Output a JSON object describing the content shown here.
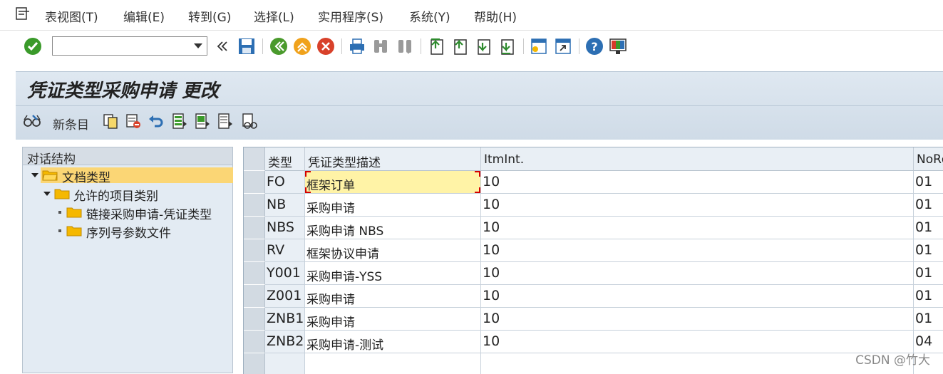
{
  "menu": {
    "items": [
      "表视图(T)",
      "编辑(E)",
      "转到(G)",
      "选择(L)",
      "实用程序(S)",
      "系统(Y)",
      "帮助(H)"
    ]
  },
  "toolbar": {
    "command_value": "",
    "icons": [
      "check-icon",
      "command-dropdown-icon",
      "double-left-icon",
      "save-icon",
      "back-icon",
      "exit-icon",
      "cancel-icon",
      "print-icon",
      "find-icon",
      "find-next-icon",
      "first-page-icon",
      "prev-page-icon",
      "next-page-icon",
      "last-page-icon",
      "new-session-icon",
      "shortcut-icon",
      "help-icon",
      "customize-layout-icon"
    ]
  },
  "title": "凭证类型采购申请 更改",
  "app_toolbar": {
    "new_entries": "新条目",
    "icons": [
      "glasses-icon",
      "copy-icon",
      "delete-icon",
      "undo-icon",
      "select-all-icon",
      "select-block-icon",
      "deselect-all-icon",
      "config-icon"
    ]
  },
  "tree": {
    "header": "对话结构",
    "nodes": [
      {
        "label": "文档类型",
        "level": 0,
        "expanded": true,
        "selected": true
      },
      {
        "label": "允许的项目类别",
        "level": 1,
        "expanded": true,
        "selected": false
      },
      {
        "label": "链接采购申请-凭证类型",
        "level": 2,
        "expanded": false,
        "selected": false
      },
      {
        "label": "序列号参数文件",
        "level": 2,
        "expanded": false,
        "selected": false
      }
    ]
  },
  "table": {
    "columns": [
      "类型",
      "凭证类型描述",
      "ItmInt.",
      "NoRg"
    ],
    "rows": [
      [
        "FO",
        "框架订单",
        "10",
        "01"
      ],
      [
        "NB",
        "采购申请",
        "10",
        "01"
      ],
      [
        "NBS",
        "采购申请 NBS",
        "10",
        "01"
      ],
      [
        "RV",
        "框架协议申请",
        "10",
        "01"
      ],
      [
        "Y001",
        "采购申请-YSS",
        "10",
        "01"
      ],
      [
        "Z001",
        "采购申请",
        "10",
        "01"
      ],
      [
        "ZNB1",
        "采购申请",
        "10",
        "01"
      ],
      [
        "ZNB2",
        "采购申请-测试",
        "10",
        "04"
      ]
    ]
  },
  "watermark": "CSDN @竹大",
  "colors": {
    "title_bg": "#d6e1ec",
    "selected_node": "#fbd675",
    "focus_cell": "#fff3a6",
    "folder": "#f5b800"
  }
}
